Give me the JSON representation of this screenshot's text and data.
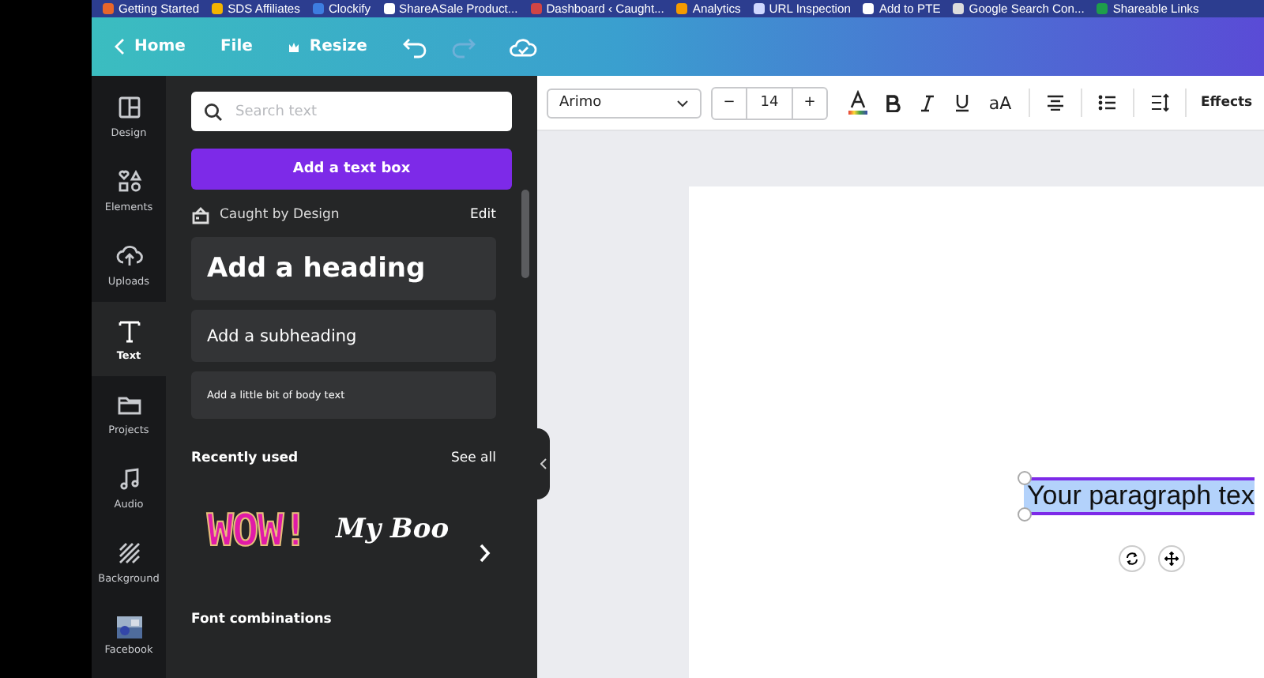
{
  "bookmarks": [
    {
      "label": "Getting Started"
    },
    {
      "label": "SDS Affiliates"
    },
    {
      "label": "Clockify"
    },
    {
      "label": "ShareASale Product..."
    },
    {
      "label": "Dashboard ‹ Caught..."
    },
    {
      "label": "Analytics"
    },
    {
      "label": "URL Inspection"
    },
    {
      "label": "Add to PTE"
    },
    {
      "label": "Google Search Con..."
    },
    {
      "label": "Shareable Links"
    }
  ],
  "header": {
    "home": "Home",
    "file": "File",
    "resize": "Resize",
    "history": [
      {
        "kind": "undo",
        "disabled": false
      },
      {
        "kind": "redo",
        "disabled": true
      }
    ]
  },
  "rail": [
    {
      "kind": "design",
      "label": "Design",
      "selected": false
    },
    {
      "kind": "elements",
      "label": "Elements",
      "selected": false
    },
    {
      "kind": "uploads",
      "label": "Uploads",
      "selected": false
    },
    {
      "kind": "text",
      "label": "Text",
      "selected": true
    },
    {
      "kind": "projects",
      "label": "Projects",
      "selected": false
    },
    {
      "kind": "audio",
      "label": "Audio",
      "selected": false
    },
    {
      "kind": "background",
      "label": "Background",
      "selected": false
    },
    {
      "kind": "facebook",
      "label": "Facebook",
      "selected": false
    }
  ],
  "panel": {
    "search": {
      "placeholder": "Search text"
    },
    "add_button": "Add a text box",
    "brand": {
      "name": "Caught by Design",
      "action": "Edit"
    },
    "styles": [
      {
        "kind": "heading",
        "label": "Add a heading"
      },
      {
        "kind": "subheading",
        "label": "Add a subheading"
      },
      {
        "kind": "body",
        "label": "Add a little bit of body text"
      }
    ],
    "recent": {
      "title": "Recently used",
      "action": "See all",
      "items": [
        {
          "kind": "wow",
          "label": "WOW!"
        },
        {
          "kind": "serif",
          "label": "My Boo"
        }
      ]
    },
    "next_section": "Font combinations"
  },
  "toolbar": {
    "font": "Arimo",
    "decrease": "−",
    "size": "14",
    "increase": "+",
    "case": "aA",
    "effects": "Effects"
  },
  "canvas": {
    "text": "Your paragraph tex",
    "selected": true
  }
}
